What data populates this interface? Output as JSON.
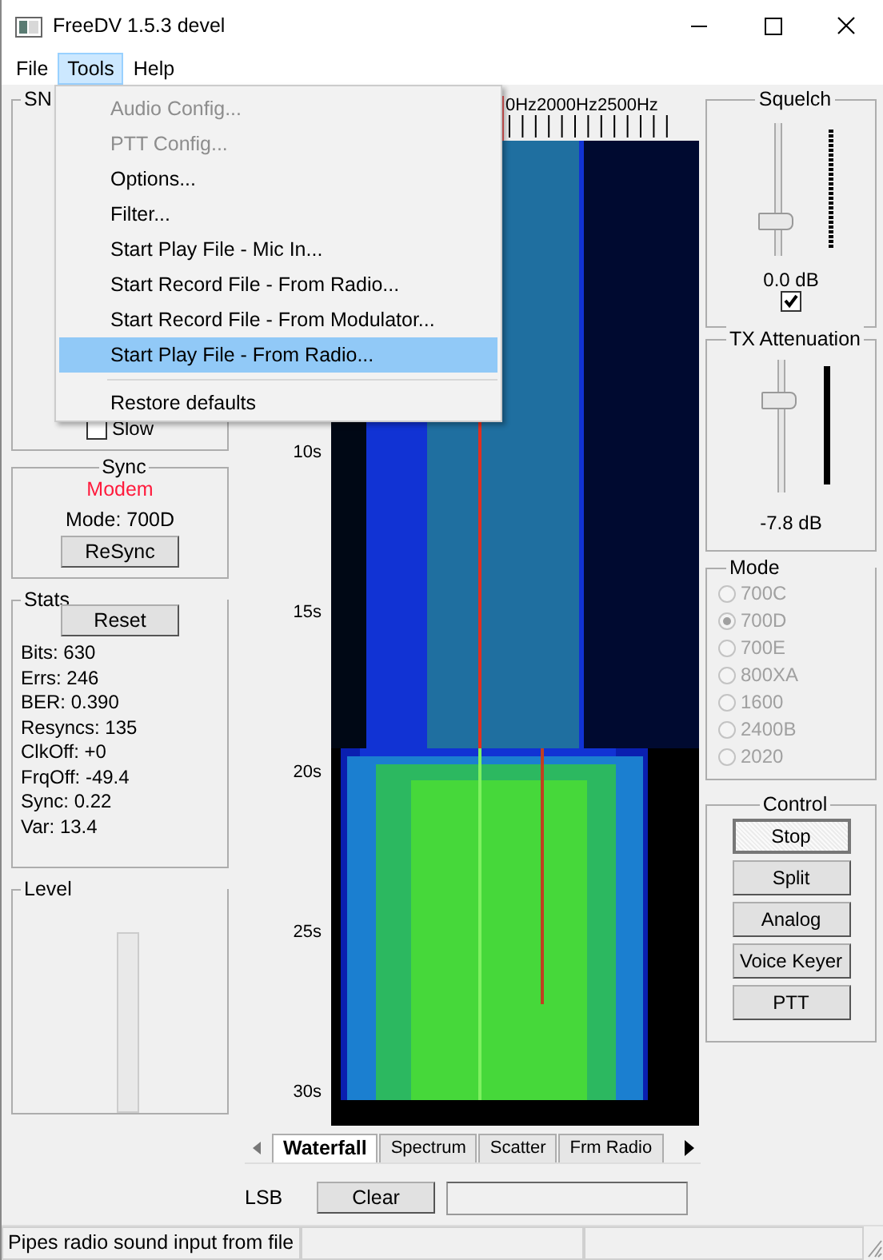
{
  "window": {
    "title": "FreeDV 1.5.3 devel"
  },
  "menu_bar": [
    {
      "label": "File",
      "selected": false
    },
    {
      "label": "Tools",
      "selected": true
    },
    {
      "label": "Help",
      "selected": false
    }
  ],
  "tools_menu": [
    {
      "kind": "item",
      "label": "Audio Config...",
      "disabled": true,
      "selected": false
    },
    {
      "kind": "item",
      "label": "PTT Config...",
      "disabled": true,
      "selected": false
    },
    {
      "kind": "item",
      "label": "Options...",
      "disabled": false,
      "selected": false
    },
    {
      "kind": "item",
      "label": "Filter...",
      "disabled": false,
      "selected": false
    },
    {
      "kind": "item",
      "label": "Start Play File - Mic In...",
      "disabled": false,
      "selected": false
    },
    {
      "kind": "item",
      "label": "Start Record File - From Radio...",
      "disabled": false,
      "selected": false
    },
    {
      "kind": "item",
      "label": "Start Record File - From Modulator...",
      "disabled": false,
      "selected": false
    },
    {
      "kind": "item",
      "label": "Start Play File - From Radio...",
      "disabled": false,
      "selected": true
    },
    {
      "kind": "separator"
    },
    {
      "kind": "item",
      "label": "Restore defaults",
      "disabled": false,
      "selected": false
    }
  ],
  "snr": {
    "title": "SN",
    "slow": {
      "label": "Slow",
      "checked": false
    }
  },
  "sync": {
    "title": "Sync",
    "status": "Modem",
    "mode": "Mode: 700D",
    "button": "ReSync"
  },
  "stats": {
    "title": "Stats",
    "button": "Reset",
    "lines": [
      "Bits: 630",
      "Errs: 246",
      "BER: 0.390",
      "Resyncs: 135",
      "ClkOff: +0",
      "FrqOff: -49.4",
      "Sync: 0.22",
      "Var: 13.4"
    ]
  },
  "level": {
    "title": "Level"
  },
  "waterfall": {
    "freq_labels": "0Hz2000Hz2500Hz",
    "time_labels": [
      "10s",
      "15s",
      "20s",
      "25s",
      "30s"
    ]
  },
  "tabs": [
    {
      "label": "Waterfall",
      "selected": true
    },
    {
      "label": "Spectrum",
      "selected": false
    },
    {
      "label": "Scatter",
      "selected": false
    },
    {
      "label": "Frm Radio",
      "selected": false
    }
  ],
  "bottom": {
    "sideband": "LSB",
    "button": "Clear"
  },
  "squelch": {
    "title": "Squelch",
    "level": 0.22,
    "reading": "0.0 dB",
    "checked": true
  },
  "tx_attenuation": {
    "title": "TX Attenuation",
    "level": 0.72,
    "reading": "-7.8 dB"
  },
  "mode": {
    "title": "Mode",
    "options": [
      {
        "label": "700C",
        "selected": false,
        "disabled": true
      },
      {
        "label": "700D",
        "selected": true,
        "disabled": true
      },
      {
        "label": "700E",
        "selected": false,
        "disabled": true
      },
      {
        "label": "800XA",
        "selected": false,
        "disabled": true
      },
      {
        "label": "1600",
        "selected": false,
        "disabled": true
      },
      {
        "label": "2400B",
        "selected": false,
        "disabled": true
      },
      {
        "label": "2020",
        "selected": false,
        "disabled": true
      }
    ]
  },
  "control": {
    "title": "Control",
    "buttons": [
      {
        "label": "Stop",
        "pressed": true
      },
      {
        "label": "Split",
        "pressed": false
      },
      {
        "label": "Analog",
        "pressed": false
      },
      {
        "label": "Voice Keyer",
        "pressed": false
      },
      {
        "label": "PTT",
        "pressed": false
      }
    ]
  },
  "status_bar": [
    "Pipes radio sound input from file"
  ]
}
